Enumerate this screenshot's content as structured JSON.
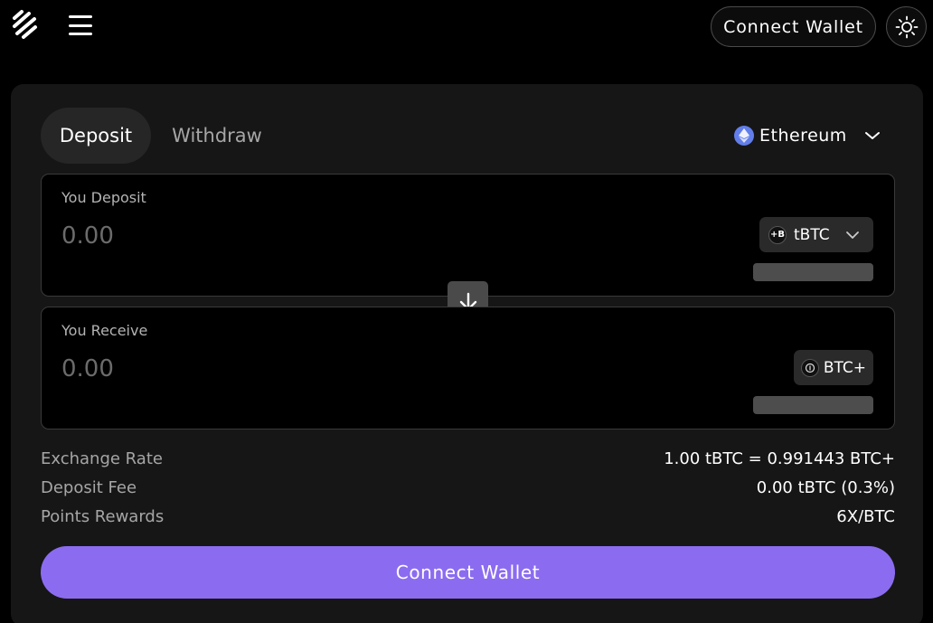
{
  "header": {
    "logo_icon": "stacked-slashes-logo-icon",
    "menu_icon": "hamburger-menu-icon",
    "connect_wallet_label": "Connect Wallet",
    "theme_icon": "sun-icon"
  },
  "tabs": [
    {
      "label": "Deposit",
      "active": true
    },
    {
      "label": "Withdraw",
      "active": false
    }
  ],
  "network": {
    "label": "Ethereum",
    "icon": "ethereum-icon"
  },
  "deposit_box": {
    "label": "You Deposit",
    "placeholder": "0.00",
    "token": "tBTC",
    "token_icon_text": "+B"
  },
  "receive_box": {
    "label": "You Receive",
    "placeholder": "0.00",
    "token": "BTC+"
  },
  "info": {
    "exchange_rate_label": "Exchange Rate",
    "exchange_rate_value": "1.00 tBTC = 0.991443 BTC+",
    "deposit_fee_label": "Deposit Fee",
    "deposit_fee_value": "0.00 tBTC (0.3%)",
    "points_rewards_label": "Points Rewards",
    "points_rewards_value": "6X/BTC"
  },
  "main_button_label": "Connect Wallet",
  "colors": {
    "accent": "#8b6cf0",
    "background": "#000000",
    "card": "#161616"
  }
}
